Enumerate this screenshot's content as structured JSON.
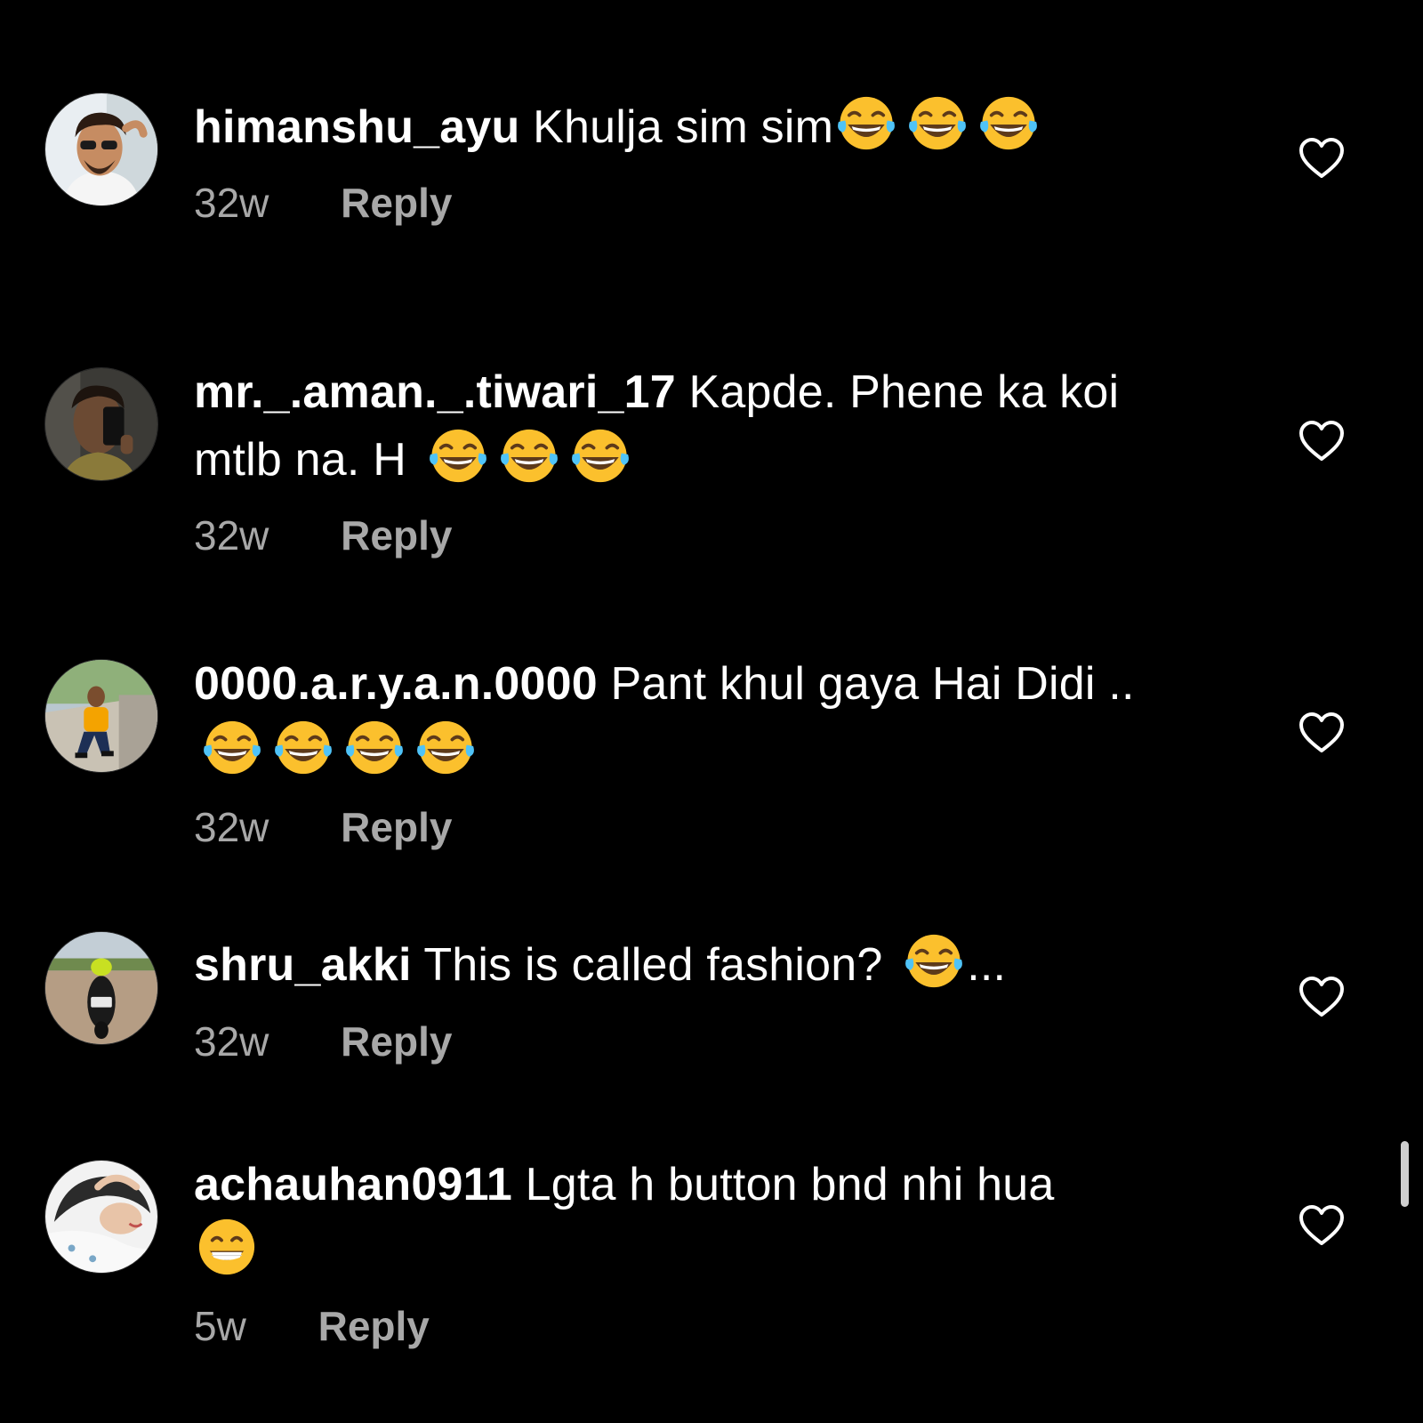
{
  "colors": {
    "background": "#000000",
    "text": "#ffffff",
    "secondary_text": "#a8a8a8",
    "emoji_yellow": "#fbc02d",
    "tear_blue": "#4fc3f7"
  },
  "comments": [
    {
      "username": "himanshu_ayu",
      "text": "Khulja sim sim",
      "emoji": [
        "face-with-tears-of-joy",
        "face-with-tears-of-joy",
        "face-with-tears-of-joy"
      ],
      "age": "32w",
      "reply_label": "Reply",
      "avatar_icon": "avatar-photo-man-sunglasses"
    },
    {
      "username": "mr._.aman._.tiwari_17",
      "text": "Kapde. Phene ka koi mtlb na. H",
      "emoji": [
        "face-with-tears-of-joy",
        "face-with-tears-of-joy",
        "face-with-tears-of-joy"
      ],
      "age": "32w",
      "reply_label": "Reply",
      "avatar_icon": "avatar-photo-mirror-selfie"
    },
    {
      "username": "0000.a.r.y.a.n.0000",
      "text": "Pant khul gaya Hai Didi ..",
      "emoji": [
        "face-with-tears-of-joy",
        "face-with-tears-of-joy",
        "face-with-tears-of-joy",
        "face-with-tears-of-joy"
      ],
      "age": "32w",
      "reply_label": "Reply",
      "avatar_icon": "avatar-photo-man-sitting"
    },
    {
      "username": "shru_akki",
      "text": "This is called fashion?",
      "emoji": [
        "face-with-tears-of-joy"
      ],
      "suffix": "...",
      "age": "32w",
      "reply_label": "Reply",
      "avatar_icon": "avatar-photo-motorcycle"
    },
    {
      "username": "achauhan0911",
      "text": "Lgta h button bnd nhi hua",
      "emoji": [
        "grinning-face-with-smiling-eyes"
      ],
      "age": "5w",
      "reply_label": "Reply",
      "avatar_icon": "avatar-photo-woman-lying"
    }
  ],
  "like_icon": "heart-outline-icon"
}
